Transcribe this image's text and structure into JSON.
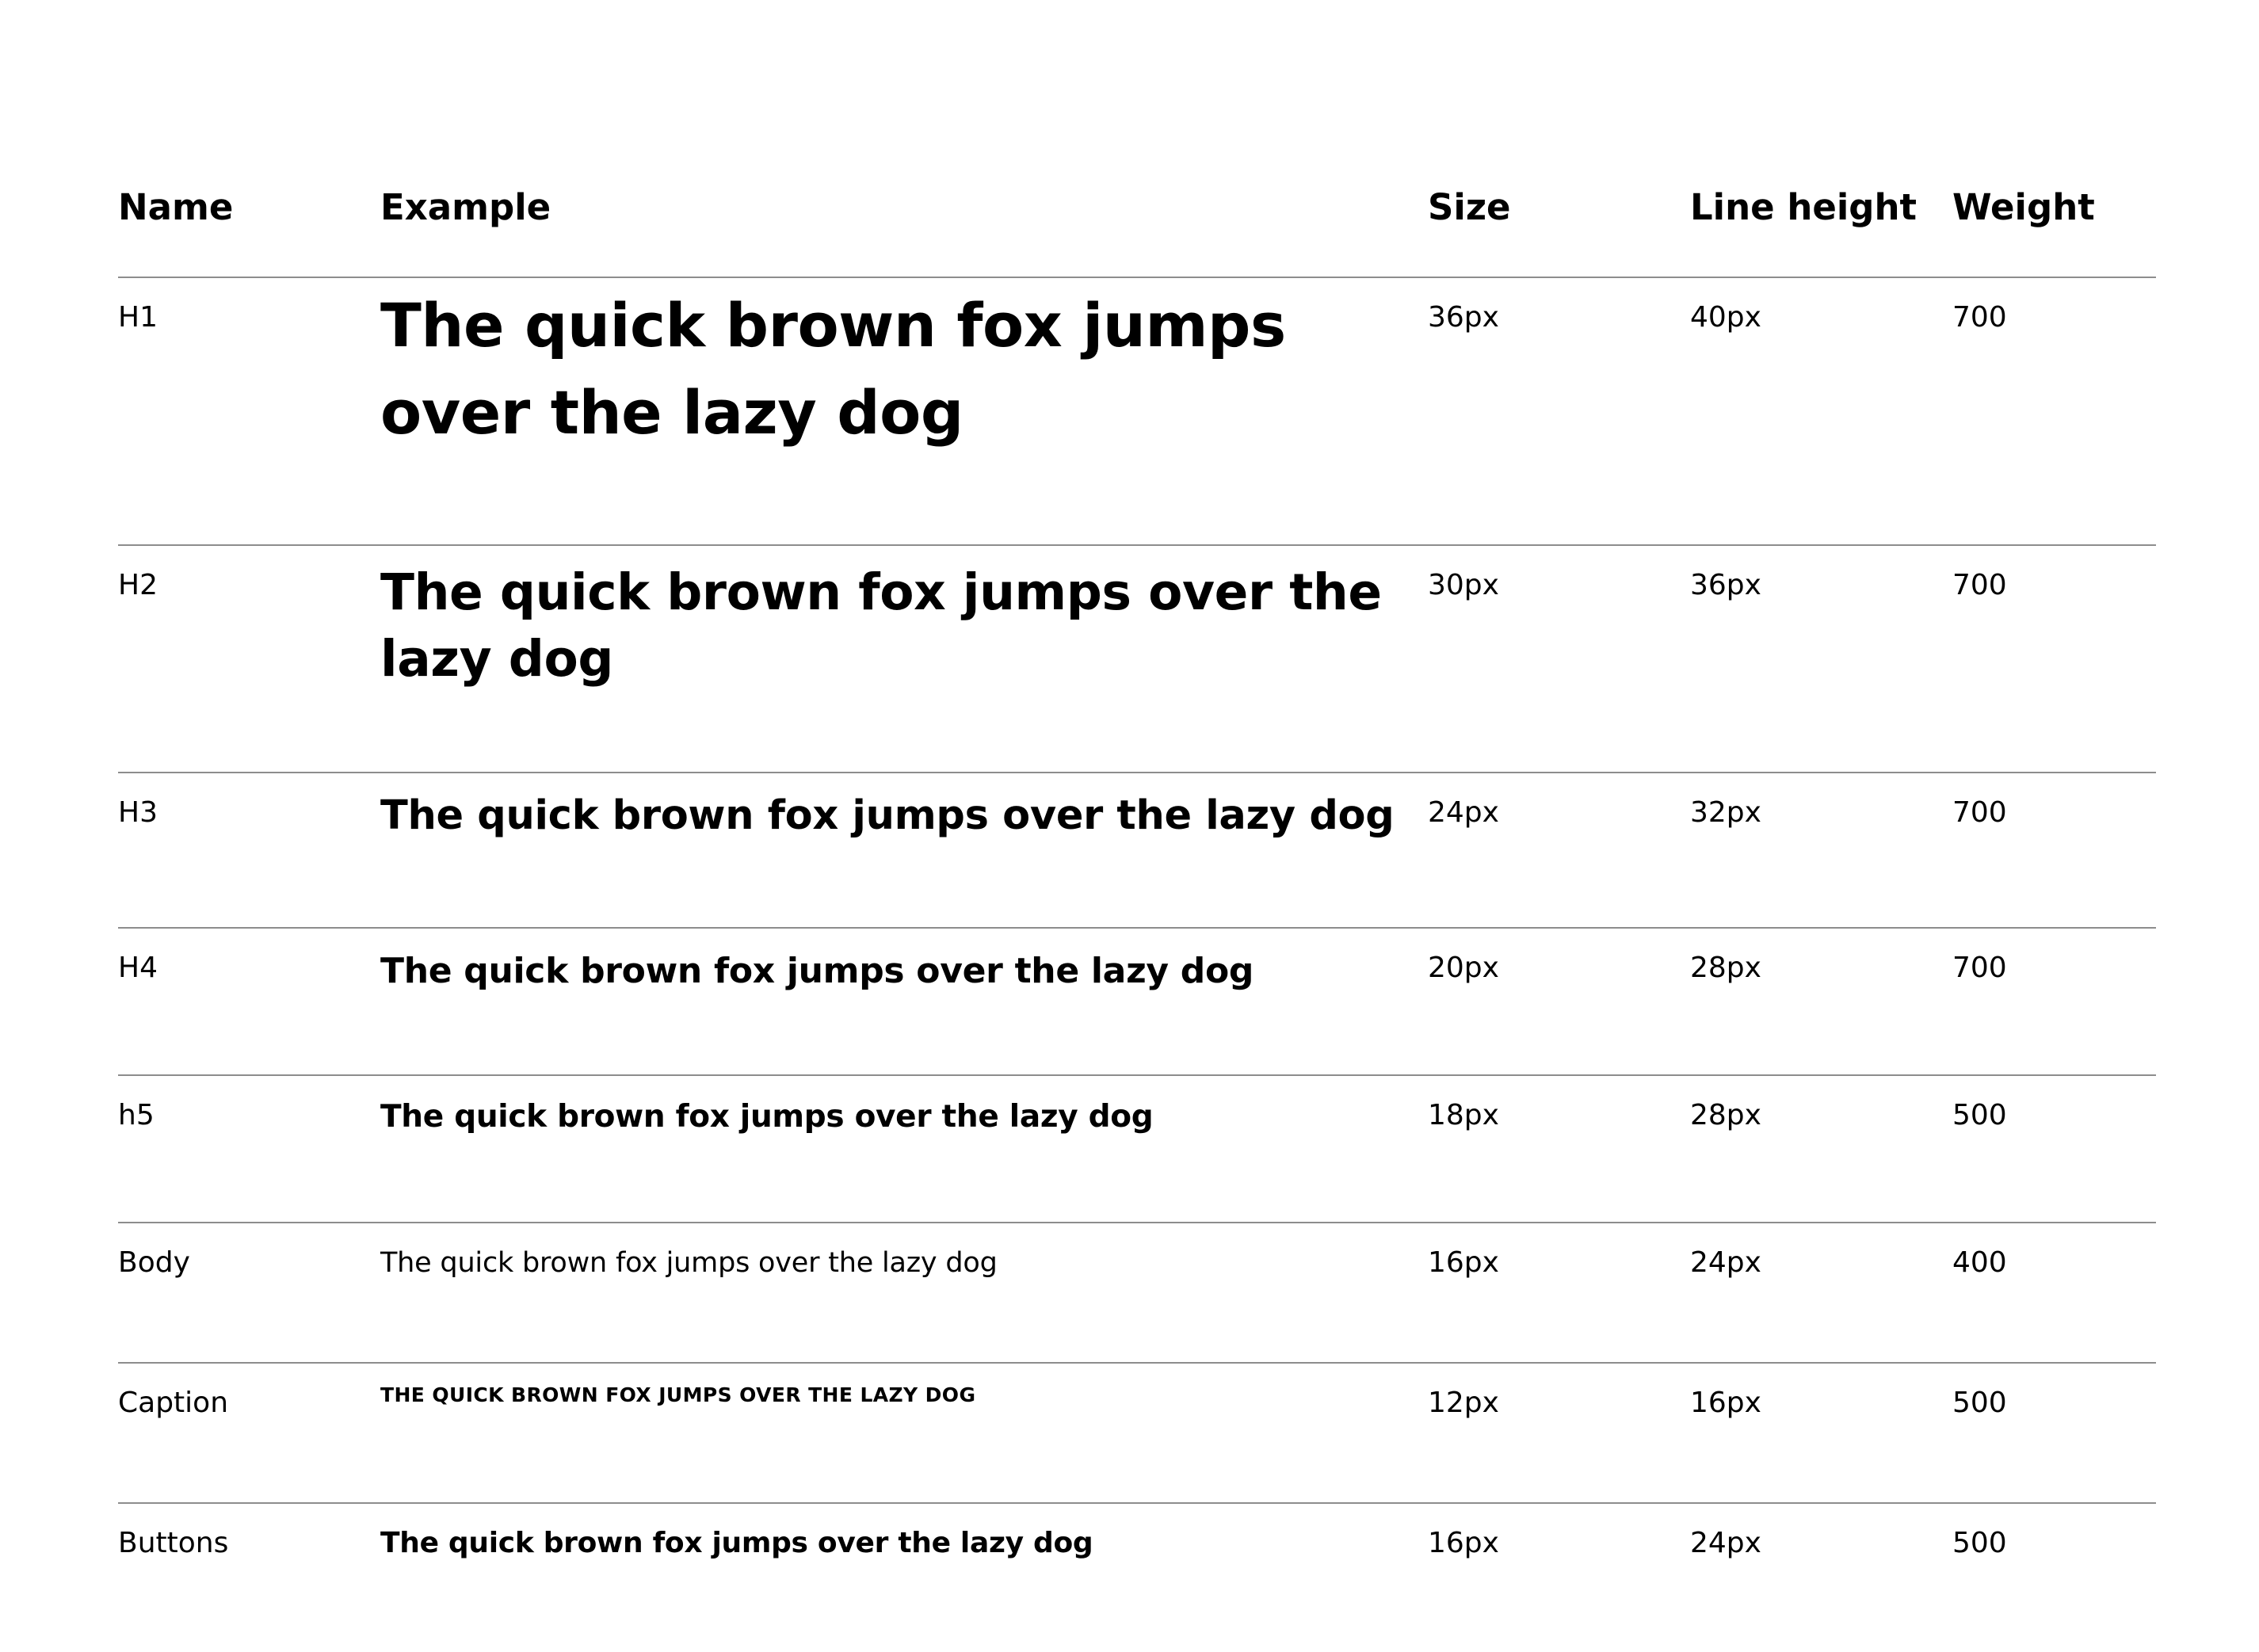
{
  "table": {
    "headers": {
      "name": "Name",
      "example": "Example",
      "size": "Size",
      "line_height": "Line height",
      "weight": "Weight"
    },
    "rows": [
      {
        "name": "H1",
        "example": "The quick brown fox jumps over the lazy dog",
        "size": "36px",
        "line_height": "40px",
        "weight": "700"
      },
      {
        "name": "H2",
        "example": "The quick brown fox jumps over the lazy dog",
        "size": "30px",
        "line_height": "36px",
        "weight": "700"
      },
      {
        "name": "H3",
        "example": "The quick brown fox jumps over the lazy dog",
        "size": "24px",
        "line_height": "32px",
        "weight": "700"
      },
      {
        "name": "H4",
        "example": "The quick brown fox jumps over the lazy dog",
        "size": "20px",
        "line_height": "28px",
        "weight": "700"
      },
      {
        "name": "h5",
        "example": "The quick brown fox jumps over the lazy dog",
        "size": "18px",
        "line_height": "28px",
        "weight": "500"
      },
      {
        "name": "Body",
        "example": "The quick brown fox jumps over the lazy dog",
        "size": "16px",
        "line_height": "24px",
        "weight": "400"
      },
      {
        "name": "Caption",
        "example": "THE QUICK BROWN FOX JUMPS OVER THE LAZY DOG",
        "size": "12px",
        "line_height": "16px",
        "weight": "500"
      },
      {
        "name": "Buttons",
        "example": "The quick brown fox jumps over the lazy dog",
        "size": "16px",
        "line_height": "24px",
        "weight": "500"
      }
    ]
  },
  "colors": {
    "text": "#000000",
    "divider": "#8d8d8d",
    "background": "#ffffff"
  }
}
